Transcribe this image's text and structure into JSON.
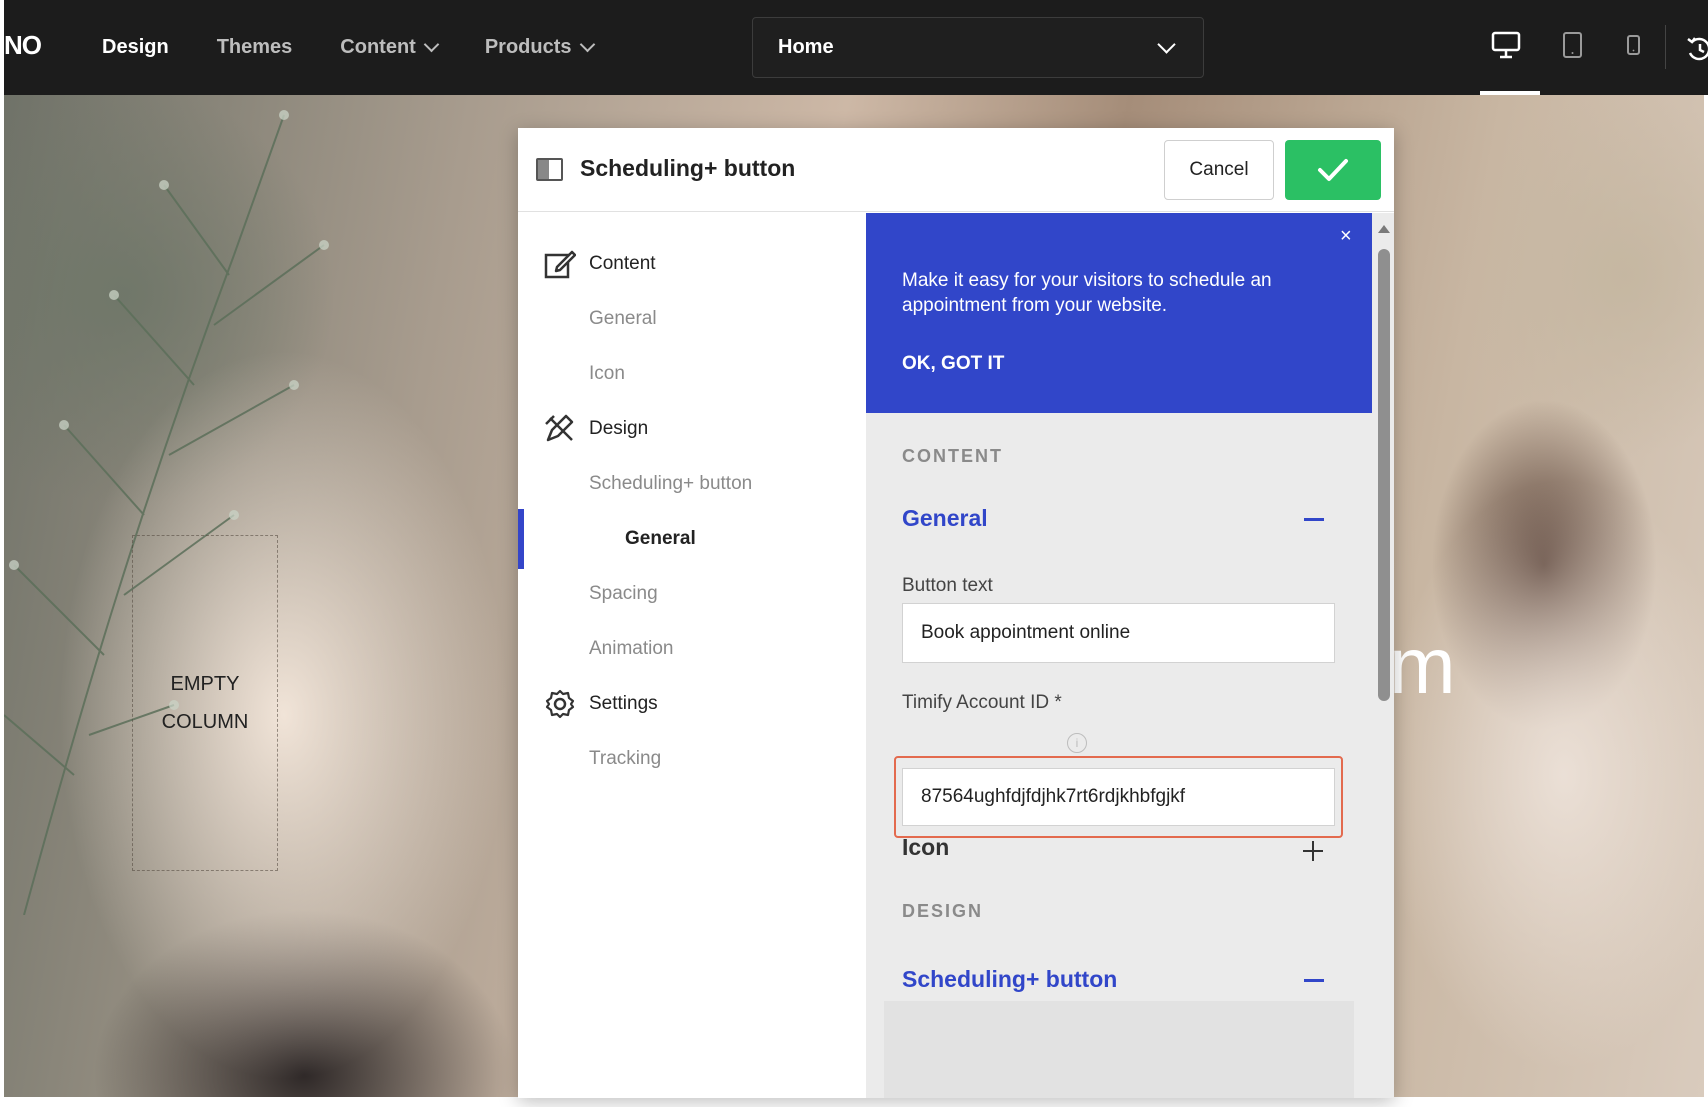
{
  "topbar": {
    "logo_fragment": "NO",
    "nav": [
      {
        "label": "Design",
        "active": true,
        "has_dropdown": false
      },
      {
        "label": "Themes",
        "active": false,
        "has_dropdown": false
      },
      {
        "label": "Content",
        "active": false,
        "has_dropdown": true
      },
      {
        "label": "Products",
        "active": false,
        "has_dropdown": true
      }
    ],
    "page_select": {
      "value": "Home"
    },
    "devices": [
      "desktop-icon",
      "tablet-icon",
      "mobile-icon"
    ],
    "active_device": "desktop",
    "history_icon": "history-icon"
  },
  "canvas": {
    "empty_column_line1": "EMPTY",
    "empty_column_line2": "COLUMN",
    "heading_fragment": "m"
  },
  "modal": {
    "title": "Scheduling+ button",
    "cancel_label": "Cancel",
    "confirm_icon": "checkmark-icon",
    "leftnav": {
      "content": "Content",
      "content_general": "General",
      "content_icon": "Icon",
      "design": "Design",
      "design_scheduling_button": "Scheduling+ button",
      "design_general": "General",
      "design_spacing": "Spacing",
      "design_animation": "Animation",
      "settings": "Settings",
      "settings_tracking": "Tracking",
      "active_item": "General"
    },
    "promo": {
      "text": "Make it easy for your visitors to schedule an appointment from your website.",
      "ok_label": "OK, GOT IT",
      "close_label": "×"
    },
    "panel": {
      "content_section": "CONTENT",
      "general_title": "General",
      "button_text_label": "Button text",
      "button_text_value": "Book appointment online",
      "account_id_label": "Timify Account ID *",
      "account_id_value": "87564ughfdjfdjhk7rt6rdjkhbfgjkf",
      "icon_title": "Icon",
      "design_section": "DESIGN",
      "scheduling_title": "Scheduling+ button"
    }
  },
  "colors": {
    "topbar_bg": "#1c1c1c",
    "accent_blue": "#3146c9",
    "confirm_green": "#2bc064",
    "highlight_orange": "#e36a4e",
    "panel_bg": "#ebebeb"
  }
}
